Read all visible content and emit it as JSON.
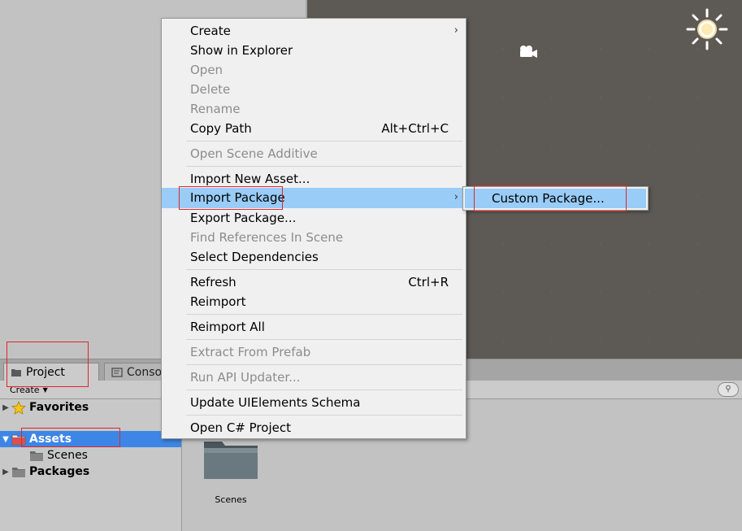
{
  "project_panel": {
    "tabs": [
      {
        "label": "Project",
        "icon": "folder-icon"
      },
      {
        "label": "Conso",
        "icon": "console-icon"
      }
    ],
    "create_label": "Create",
    "tree": [
      {
        "label": "Favorites",
        "icon": "star-icon",
        "expanded": false
      },
      {
        "label": "Assets",
        "icon": "folder-icon",
        "expanded": true,
        "selected": true
      },
      {
        "label": "Scenes",
        "icon": "folder-icon"
      },
      {
        "label": "Packages",
        "icon": "folder-icon",
        "expanded": false
      }
    ],
    "assets": [
      {
        "label": "Scenes",
        "icon": "folder-icon"
      }
    ]
  },
  "scene_view": {
    "icons": [
      "sun-icon",
      "camera-icon"
    ]
  },
  "context_menu": {
    "items": [
      {
        "label": "Create",
        "submenu": true
      },
      {
        "label": "Show in Explorer"
      },
      {
        "label": "Open",
        "disabled": true
      },
      {
        "label": "Delete",
        "disabled": true
      },
      {
        "label": "Rename",
        "disabled": true
      },
      {
        "label": "Copy Path",
        "shortcut": "Alt+Ctrl+C"
      },
      {
        "label": "Open Scene Additive",
        "disabled": true
      },
      {
        "label": "Import New Asset..."
      },
      {
        "label": "Import Package",
        "submenu": true,
        "highlighted": true
      },
      {
        "label": "Export Package..."
      },
      {
        "label": "Find References In Scene",
        "disabled": true
      },
      {
        "label": "Select Dependencies"
      },
      {
        "label": "Refresh",
        "shortcut": "Ctrl+R"
      },
      {
        "label": "Reimport"
      },
      {
        "label": "Reimport All"
      },
      {
        "label": "Extract From Prefab",
        "disabled": true
      },
      {
        "label": "Run API Updater...",
        "disabled": true
      },
      {
        "label": "Update UIElements Schema"
      },
      {
        "label": "Open C# Project"
      }
    ]
  },
  "submenu": {
    "items": [
      {
        "label": "Custom Package...",
        "highlighted": true
      }
    ]
  },
  "colors": {
    "highlight": "#99ccf7",
    "selection": "#3d86e6",
    "annotation": "#e0262b"
  }
}
